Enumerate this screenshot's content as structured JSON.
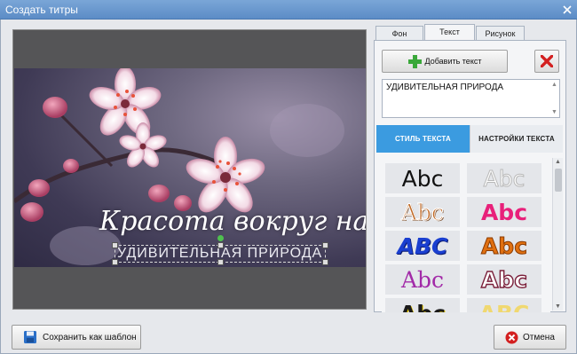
{
  "window": {
    "title": "Создать титры"
  },
  "tabs": [
    {
      "label": "Фон",
      "active": false
    },
    {
      "label": "Текст",
      "active": true
    },
    {
      "label": "Рисунок",
      "active": false
    }
  ],
  "toolbar": {
    "add_text_label": "Добавить текст"
  },
  "text_input": {
    "value": "УДИВИТЕЛЬНАЯ ПРИРОДА"
  },
  "subtabs": [
    {
      "label": "СТИЛЬ ТЕКСТА",
      "active": true
    },
    {
      "label": "НАСТРОЙКИ ТЕКСТА",
      "active": false
    }
  ],
  "styles": [
    {
      "label": "Abc",
      "color": "#111111"
    },
    {
      "label": "Abc",
      "color": "#ffffff"
    },
    {
      "label": "Abc",
      "color": "#c06a28"
    },
    {
      "label": "Abc",
      "color": "#e8207a"
    },
    {
      "label": "ABC",
      "color": "#1a3fd0"
    },
    {
      "label": "Abc",
      "color": "#e07010"
    },
    {
      "label": "Abc",
      "color": "#a22aa8"
    },
    {
      "label": "Abc",
      "color": "#ffffff"
    },
    {
      "label": "Abc",
      "color": "#1a1a1a"
    },
    {
      "label": "ABC",
      "color": "#f0d870"
    }
  ],
  "preview": {
    "title_text": "Красота вокруг нас",
    "subtitle_text": "УДИВИТЕЛЬНАЯ ПРИРОДА"
  },
  "footer": {
    "save_template_label": "Сохранить как шаблон",
    "cancel_label": "Отмена"
  },
  "colors": {
    "accent": "#3b9be0",
    "titlebar": "#6a97cf",
    "delete_red": "#d32020",
    "add_green": "#3aa83a"
  },
  "icons": [
    "close-icon",
    "plus-icon",
    "delete-icon",
    "save-icon",
    "cancel-icon"
  ]
}
